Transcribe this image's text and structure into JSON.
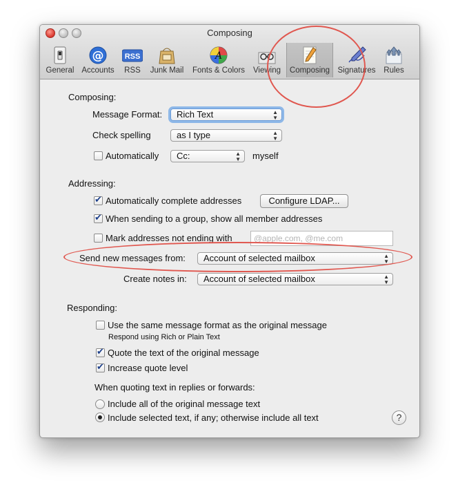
{
  "window": {
    "title": "Composing"
  },
  "toolbar": {
    "items": [
      {
        "label": "General",
        "icon": "light-switch-icon"
      },
      {
        "label": "Accounts",
        "icon": "at-sign-icon"
      },
      {
        "label": "RSS",
        "icon": "rss-icon"
      },
      {
        "label": "Junk Mail",
        "icon": "junk-mail-bag-icon"
      },
      {
        "label": "Fonts & Colors",
        "icon": "color-palette-icon"
      },
      {
        "label": "Viewing",
        "icon": "glasses-icon"
      },
      {
        "label": "Composing",
        "icon": "pencil-icon",
        "selected": true
      },
      {
        "label": "Signatures",
        "icon": "fountain-pen-icon"
      },
      {
        "label": "Rules",
        "icon": "rules-arrows-icon"
      }
    ]
  },
  "composing": {
    "heading": "Composing:",
    "message_format_label": "Message Format:",
    "message_format_value": "Rich Text",
    "check_spelling_label": "Check spelling",
    "check_spelling_value": "as I type",
    "auto_cc_label": "Automatically",
    "auto_cc_checked": false,
    "auto_cc_value": "Cc:",
    "auto_cc_suffix": "myself"
  },
  "addressing": {
    "heading": "Addressing:",
    "auto_complete_label": "Automatically complete addresses",
    "auto_complete_checked": true,
    "configure_ldap_label": "Configure LDAP...",
    "group_members_label": "When sending to a group, show all member addresses",
    "group_members_checked": true,
    "mark_addresses_label": "Mark addresses not ending with",
    "mark_addresses_checked": false,
    "mark_addresses_placeholder": "@apple.com, @me.com",
    "send_from_label": "Send new messages from:",
    "send_from_value": "Account of selected mailbox",
    "create_notes_label": "Create notes in:",
    "create_notes_value": "Account of selected mailbox"
  },
  "responding": {
    "heading": "Responding:",
    "same_format_label": "Use the same message format as the original message",
    "same_format_checked": false,
    "same_format_hint": "Respond using Rich or Plain Text",
    "quote_text_label": "Quote the text of the original message",
    "quote_text_checked": true,
    "increase_quote_label": "Increase quote level",
    "increase_quote_checked": true,
    "quoting_heading": "When quoting text in replies or forwards:",
    "include_all_label": "Include all of the original message text",
    "include_selected_label": "Include selected text, if any; otherwise include all text",
    "selected_option": "include_selected"
  },
  "help_label": "?",
  "colors": {
    "annotation": "#e0574f",
    "focus_ring": "#6ea5e6"
  }
}
